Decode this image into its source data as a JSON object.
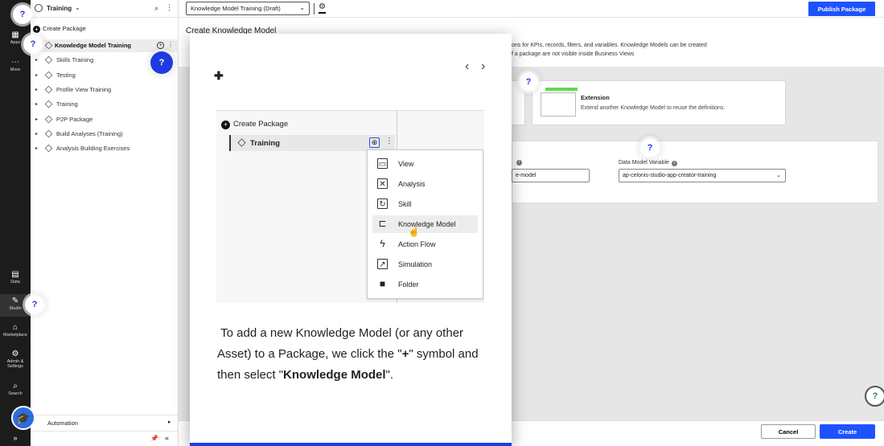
{
  "rail": {
    "items": [
      {
        "label": "Apps",
        "icon": "grid-icon"
      },
      {
        "label": "More",
        "icon": "more-icon"
      },
      {
        "label": "Data",
        "icon": "data-icon"
      },
      {
        "label": "Studio",
        "icon": "studio-icon"
      },
      {
        "label": "Marketplace",
        "icon": "marketplace-icon"
      },
      {
        "label": "Admin & Settings",
        "icon": "admin-icon"
      },
      {
        "label": "Search",
        "icon": "search-icon"
      }
    ]
  },
  "sidebar": {
    "space_title": "Training",
    "create_package": "Create Package",
    "tree": [
      {
        "label": "Knowledge Model Training",
        "selected": true,
        "level": 0
      },
      {
        "label": "Skills Training",
        "level": 1
      },
      {
        "label": "Testing",
        "level": 1
      },
      {
        "label": "Profile View Training",
        "level": 1
      },
      {
        "label": "Training",
        "level": 1
      },
      {
        "label": "P2P Package",
        "level": 1
      },
      {
        "label": "Build Analyses (Training)",
        "level": 1
      },
      {
        "label": "Analysis Building Exercises",
        "level": 1
      }
    ],
    "automation": "Automation"
  },
  "topbar": {
    "version_select": "Knowledge Model Training (Draft)",
    "publish": "Publish Package"
  },
  "main": {
    "title": "Create Knowledge Model",
    "desc_line1": "ons for KPIs, records, filters, and variables. Knowledge Models can be created",
    "desc_line2": "f a package are not visible inside Business Views",
    "extension_title": "Extension",
    "extension_desc": "Extend another Knowledge Model to reuse the definitions.",
    "id_value": "e-model",
    "data_model_label": "Data Model Variable",
    "data_model_value": "ap-celonis-studio-app-creator-training",
    "cancel": "Cancel",
    "create": "Create"
  },
  "tooltip": {
    "shot": {
      "create_package": "Create Package",
      "row_label": "Training",
      "menu": [
        {
          "label": "View",
          "icon": "view-icon"
        },
        {
          "label": "Analysis",
          "icon": "analysis-icon"
        },
        {
          "label": "Skill",
          "icon": "skill-icon"
        },
        {
          "label": "Knowledge Model",
          "icon": "knowledge-model-icon"
        },
        {
          "label": "Action Flow",
          "icon": "lightning-icon"
        },
        {
          "label": "Simulation",
          "icon": "simulation-icon"
        },
        {
          "label": "Folder",
          "icon": "folder-icon"
        }
      ]
    },
    "caption_pre": " To add a new Knowledge Model (or any other Asset) to a Package, we click the \"",
    "caption_plus": "+",
    "caption_mid": "\" symbol and then select \"",
    "caption_bold": "Knowledge Model",
    "caption_post": "\"."
  },
  "hotspot_label": "?",
  "colors": {
    "accent": "#1f52ff",
    "hotspot": "#1f3be0",
    "rail": "#1c1c1c"
  }
}
